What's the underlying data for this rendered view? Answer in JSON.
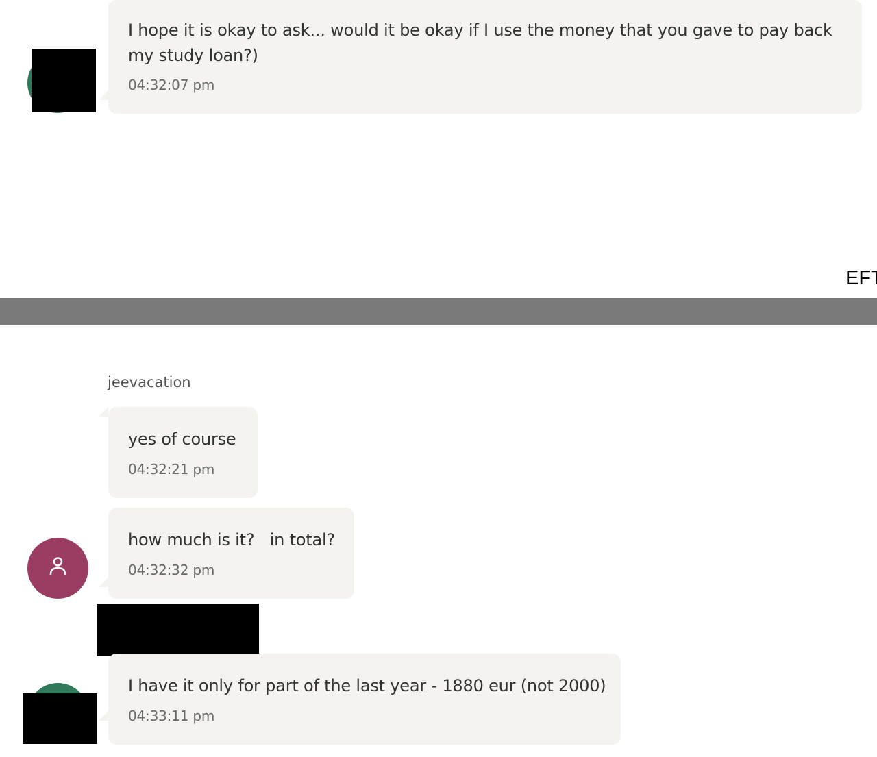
{
  "colors": {
    "bubble_bg": "#f4f3f0",
    "avatar_green": "#2e7a5a",
    "avatar_maroon": "#9b3d63",
    "divider": "#7a7a7a"
  },
  "messages": [
    {
      "text": "I hope it is okay to ask... would it be okay if I use the money that you gave to pay back my study loan?)",
      "time": "04:32:07 pm"
    },
    {
      "sender": "jeevacation",
      "text": "yes of course",
      "time": "04:32:21 pm"
    },
    {
      "text": "how much is it?   in total?",
      "time": "04:32:32 pm",
      "avatar_icon": "user-icon"
    },
    {
      "text": "I have it only for part of the last year - 1880 eur (not 2000)",
      "time": "04:33:11 pm"
    }
  ],
  "edge_label": "EFT"
}
